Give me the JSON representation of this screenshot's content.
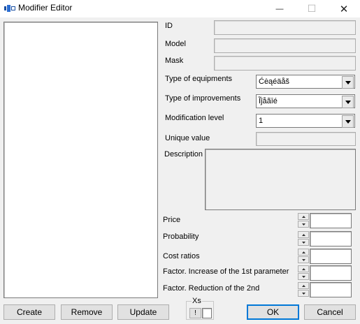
{
  "window": {
    "title": "Modifier Editor",
    "minimize_glyph": "—",
    "maximize_glyph": "☐",
    "close_glyph": "✕"
  },
  "fields": {
    "id_label": "ID",
    "id_value": "",
    "model_label": "Model",
    "model_value": "",
    "mask_label": "Mask",
    "mask_value": "",
    "type_equipment_label": "Type of equipments",
    "type_equipment_value": "Ćėąéäåš",
    "type_improvement_label": "Type of improvements",
    "type_improvement_value": "Ĩĵåãīé",
    "modification_level_label": "Modification level",
    "modification_level_value": "1",
    "unique_value_label": "Unique value",
    "unique_value_value": "",
    "description_label": "Description",
    "description_value": ""
  },
  "params": [
    {
      "label": "Price",
      "value": ""
    },
    {
      "label": "Probability",
      "value": ""
    },
    {
      "label": "Cost ratios",
      "value": ""
    },
    {
      "label": "Factor. Increase of the 1st parameter",
      "value": ""
    },
    {
      "label": "Factor. Reduction of the 2nd",
      "value": ""
    }
  ],
  "buttons": {
    "create": "Create",
    "remove": "Remove",
    "update": "Update",
    "ok": "OK",
    "cancel": "Cancel"
  },
  "xs_group": {
    "label": "Xs",
    "left_glyph": "!",
    "right_glyph": ""
  },
  "icons": {
    "app": "app-icon",
    "dropdown": "chevron-down-icon",
    "spin_up": "spin-up-icon",
    "spin_down": "spin-down-icon"
  }
}
